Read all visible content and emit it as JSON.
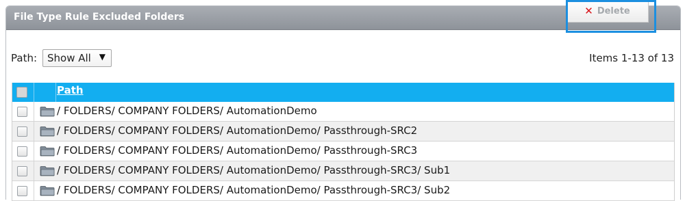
{
  "panel": {
    "title": "File Type Rule Excluded Folders",
    "delete_label": "Delete",
    "delete_icon": "x-icon"
  },
  "filter": {
    "label": "Path:",
    "selected": "Show All"
  },
  "items_count": "Items 1-13 of 13",
  "grid": {
    "header_path": "Path",
    "rows": [
      "/ FOLDERS/ COMPANY FOLDERS/ AutomationDemo",
      "/ FOLDERS/ COMPANY FOLDERS/ AutomationDemo/ Passthrough-SRC2",
      "/ FOLDERS/ COMPANY FOLDERS/ AutomationDemo/ Passthrough-SRC3",
      "/ FOLDERS/ COMPANY FOLDERS/ AutomationDemo/ Passthrough-SRC3/ Sub1",
      "/ FOLDERS/ COMPANY FOLDERS/ AutomationDemo/ Passthrough-SRC3/ Sub2"
    ]
  },
  "colors": {
    "header_gradient_top": "#a9adb3",
    "grid_header": "#13aef0",
    "highlight": "#1c8fe0",
    "delete_x": "#d8141a"
  }
}
